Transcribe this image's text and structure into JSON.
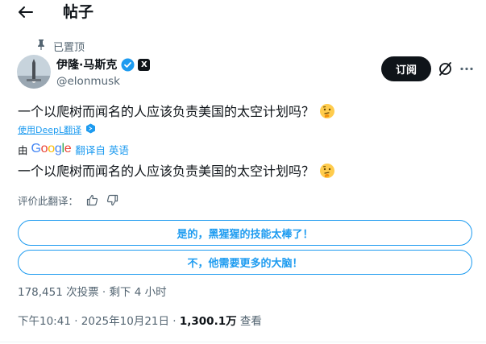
{
  "header": {
    "title": "帖子"
  },
  "post": {
    "pinned_label": "已置顶",
    "author": {
      "name": "伊隆·马斯克",
      "handle": "@elonmusk",
      "badge": "X"
    },
    "subscribe_label": "订阅",
    "text": "一个以爬树而闻名的人应该负责美国的太空计划吗？",
    "translate_link": "使用DeepL翻译",
    "google_by": "由",
    "google_logo": "Google",
    "google_from": "翻译自 英语",
    "translated_text": "一个以爬树而闻名的人应该负责美国的太空计划吗？",
    "rate_label": "评价此翻译：",
    "poll": {
      "options": [
        "是的，黑猩猩的技能太棒了！",
        "不，他需要更多的大脑！"
      ],
      "votes": "178,451 次投票",
      "separator": "·",
      "remaining": "剩下 4 小时"
    },
    "time": "下午10:41 · 2025年10月21日 · ",
    "views_count": "1,300.1万",
    "views_label": "查看"
  },
  "colors": {
    "accent": "#1d9bf0",
    "text": "#0f1419",
    "muted": "#536471"
  },
  "icons": [
    "back-arrow-icon",
    "pin-icon",
    "verified-icon",
    "x-logo-icon",
    "grok-icon",
    "more-icon",
    "thinking-face-emoji",
    "deepl-icon",
    "thumbs-up-icon",
    "thumbs-down-icon"
  ]
}
